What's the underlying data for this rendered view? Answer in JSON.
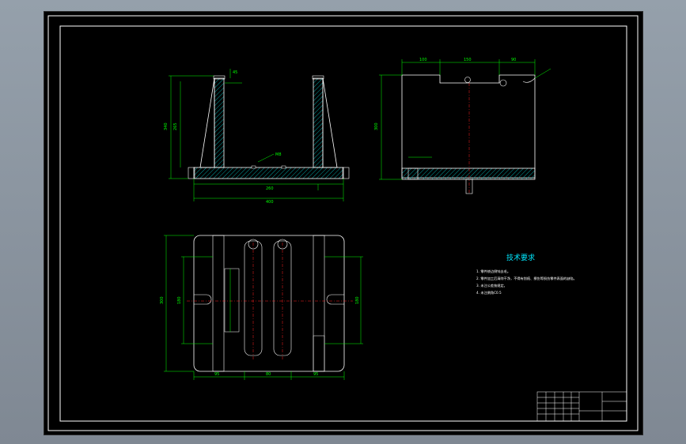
{
  "technical_requirements": {
    "title": "技术要求",
    "items": [
      "1. 零件棱边倒钝去毛。",
      "2. 零件加工后清除干净，不得有划痕、擦伤等损伤零件表面的缺陷。",
      "3. 未注公差按规定。",
      "4. 未注倒角C0.5"
    ]
  },
  "colors": {
    "background": "#000000",
    "frame": "#ffffff",
    "dimension": "#00ff00",
    "section_hatch": "#00a0a0",
    "centerline": "#ff2020",
    "title_text": "#00e8ff"
  }
}
